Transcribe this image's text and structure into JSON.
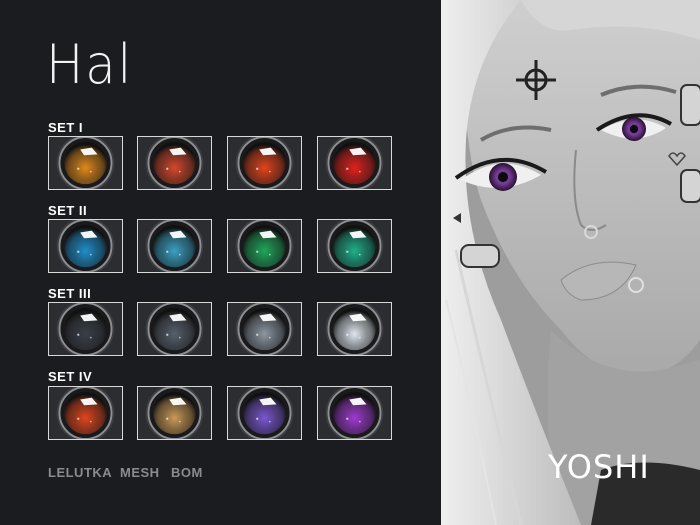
{
  "title": "Hal",
  "sets": [
    {
      "label": "SET I",
      "colors": [
        "#e0891a",
        "#d4482a",
        "#e3431b",
        "#e3201c"
      ]
    },
    {
      "label": "SET II",
      "colors": [
        "#1f8fcc",
        "#3aa0c2",
        "#1fa85a",
        "#1fb08a"
      ]
    },
    {
      "label": "SET III",
      "colors": [
        "#3a4048",
        "#56606c",
        "#8d98a2",
        "#dfe7ee"
      ]
    },
    {
      "label": "SET IV",
      "colors": [
        "#e0451c",
        "#c99a55",
        "#7a56d0",
        "#a03ad0"
      ]
    }
  ],
  "footer": [
    "LELUTKA",
    "MESH",
    "BOM"
  ],
  "brand": "YOSHI"
}
